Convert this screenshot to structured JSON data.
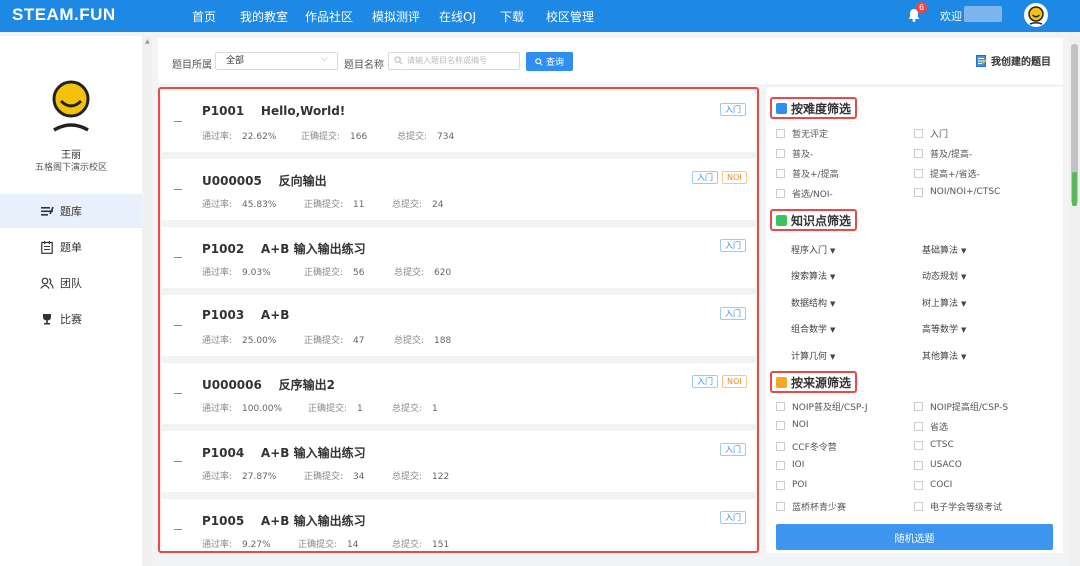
{
  "brand": "STEAM.FUN",
  "nav": [
    "首页",
    "我的教室",
    "作品社区",
    "模拟测评",
    "在线OJ",
    "下载",
    "校区管理"
  ],
  "notification_count": "6",
  "welcome": "欢迎",
  "user": {
    "name": "王丽",
    "school": "五格阁下演示校区"
  },
  "menu": [
    {
      "label": "题库",
      "icon": "list-icon"
    },
    {
      "label": "题单",
      "icon": "calendar-icon"
    },
    {
      "label": "团队",
      "icon": "team-icon"
    },
    {
      "label": "比赛",
      "icon": "trophy-icon"
    }
  ],
  "search": {
    "category_label": "题目所属",
    "category_value": "全部",
    "name_label": "题目名称",
    "placeholder": "请输入题目名称或编号",
    "button": "查询",
    "my_created": "我创建的题目"
  },
  "stat_labels": {
    "pass_rate": "通过率:",
    "correct": "正确提交:",
    "total": "总提交:"
  },
  "problems": [
    {
      "id": "P1001",
      "title": "Hello,World!",
      "pass_rate": "22.62%",
      "correct": "166",
      "total": "734",
      "tags": [
        "入门"
      ]
    },
    {
      "id": "U000005",
      "title": "反向输出",
      "pass_rate": "45.83%",
      "correct": "11",
      "total": "24",
      "tags": [
        "入门",
        "NOI"
      ]
    },
    {
      "id": "P1002",
      "title": "A+B 输入输出练习",
      "pass_rate": "9.03%",
      "correct": "56",
      "total": "620",
      "tags": [
        "入门"
      ]
    },
    {
      "id": "P1003",
      "title": "A+B",
      "pass_rate": "25.00%",
      "correct": "47",
      "total": "188",
      "tags": [
        "入门"
      ]
    },
    {
      "id": "U000006",
      "title": "反序输出2",
      "pass_rate": "100.00%",
      "correct": "1",
      "total": "1",
      "tags": [
        "入门",
        "NOI"
      ]
    },
    {
      "id": "P1004",
      "title": "A+B 输入输出练习",
      "pass_rate": "27.87%",
      "correct": "34",
      "total": "122",
      "tags": [
        "入门"
      ]
    },
    {
      "id": "P1005",
      "title": "A+B 输入输出练习",
      "pass_rate": "9.27%",
      "correct": "14",
      "total": "151",
      "tags": [
        "入门"
      ]
    }
  ],
  "filters": {
    "difficulty_title": "按难度筛选",
    "difficulty": [
      "暂无评定",
      "入门",
      "普及-",
      "普及/提高-",
      "普及+/提高",
      "提高+/省选-",
      "省选/NOI-",
      "NOI/NOI+/CTSC"
    ],
    "knowledge_title": "知识点筛选",
    "knowledge": [
      "程序入门",
      "基础算法",
      "搜索算法",
      "动态规划",
      "数据结构",
      "树上算法",
      "组合数学",
      "高等数学",
      "计算几何",
      "其他算法"
    ],
    "source_title": "按来源筛选",
    "source": [
      "NOIP普及组/CSP-J",
      "NOIP提高组/CSP-S",
      "NOI",
      "省选",
      "CCF冬令营",
      "CTSC",
      "IOI",
      "USACO",
      "POI",
      "COCI",
      "蓝桥杯青少赛",
      "电子学会等级考试"
    ],
    "random_button": "随机选题"
  },
  "colors": {
    "nav": "#1e88e5",
    "highlight": "#e84a4a",
    "tag_blue": "#2f8ff0",
    "tag_orange": "#f08a24"
  }
}
